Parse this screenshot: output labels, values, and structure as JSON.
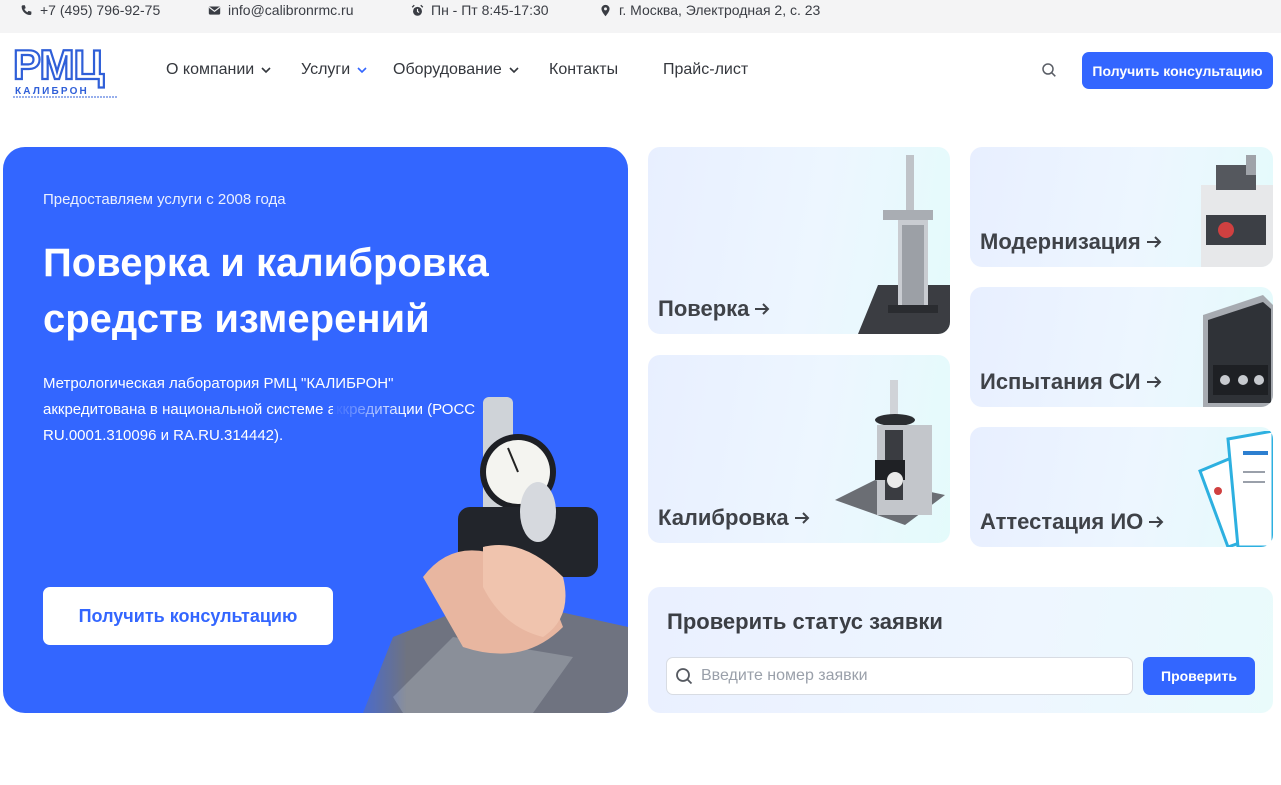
{
  "topbar": {
    "phone": "+7 (495) 796-92-75",
    "email": "info@calibronrmc.ru",
    "hours": "Пн - Пт 8:45-17:30",
    "address": "г. Москва, Электродная 2, с. 23"
  },
  "logo": {
    "main": "РМЦ",
    "sub": "КАЛИБРОН"
  },
  "nav": {
    "items": [
      {
        "label": "О компании",
        "dropdown": true
      },
      {
        "label": "Услуги",
        "dropdown": true
      },
      {
        "label": "Оборудование",
        "dropdown": true
      },
      {
        "label": "Контакты",
        "dropdown": false
      },
      {
        "label": "Прайс-лист",
        "dropdown": false
      }
    ],
    "cta_label": "Получить консультацию"
  },
  "hero": {
    "since": "Предоставляем услуги с 2008 года",
    "title_line1": "Поверка и калибровка",
    "title_line2": "средств измерений",
    "description": "Метрологическая лаборатория РМЦ \"КАЛИБРОН\" аккредитована в национальной системе аккредитации (РОСС RU.0001.310096 и RA.RU.314442).",
    "cta_label": "Получить консультацию"
  },
  "services": [
    {
      "label": "Поверка"
    },
    {
      "label": "Калибровка"
    },
    {
      "label": "Модернизация"
    },
    {
      "label": "Испытания СИ"
    },
    {
      "label": "Аттестация ИО"
    }
  ],
  "status_check": {
    "title": "Проверить статус заявки",
    "placeholder": "Введите номер заявки",
    "button_label": "Проверить"
  },
  "colors": {
    "accent": "#3366ff",
    "topbar_bg": "#f4f4f5",
    "card_bg": "#edf4ff"
  }
}
